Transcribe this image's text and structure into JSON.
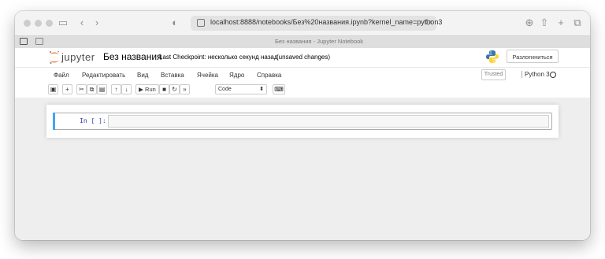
{
  "browser": {
    "url": "localhost:8888/notebooks/Без%20названия.ipynb?kernel_name=python3",
    "tab_title": "Без названия - Jupyter Notebook",
    "icons": [
      "sidebar-icon",
      "back-icon",
      "forward-icon",
      "privacy-icon",
      "reload-icon",
      "download-icon",
      "share-icon",
      "new-tab-icon",
      "tabs-icon"
    ]
  },
  "header": {
    "logo_text": "jupyter",
    "notebook_name": "Без названия",
    "checkpoint": "Last Checkpoint: несколько секунд назад",
    "unsaved": "(unsaved changes)",
    "logout_label": "Разлогиниться"
  },
  "menu": {
    "items": [
      "Файл",
      "Редактировать",
      "Вид",
      "Вставка",
      "Ячейка",
      "Ядро",
      "Справка"
    ],
    "trusted": "Trusted",
    "kernel": "Python 3"
  },
  "toolbar": {
    "run_label": "Run",
    "cell_type": "Code",
    "icons": [
      "save-icon",
      "add-cell-icon",
      "cut-icon",
      "copy-icon",
      "paste-icon",
      "move-up-icon",
      "move-down-icon",
      "run-icon",
      "stop-icon",
      "restart-icon",
      "fast-forward-icon",
      "keyboard-icon"
    ]
  },
  "cell": {
    "prompt": "In [ ]:",
    "content": ""
  },
  "colors": {
    "accent": "#42a5f5",
    "prompt": "#303f9f",
    "jupyter_orange": "#f37726"
  }
}
